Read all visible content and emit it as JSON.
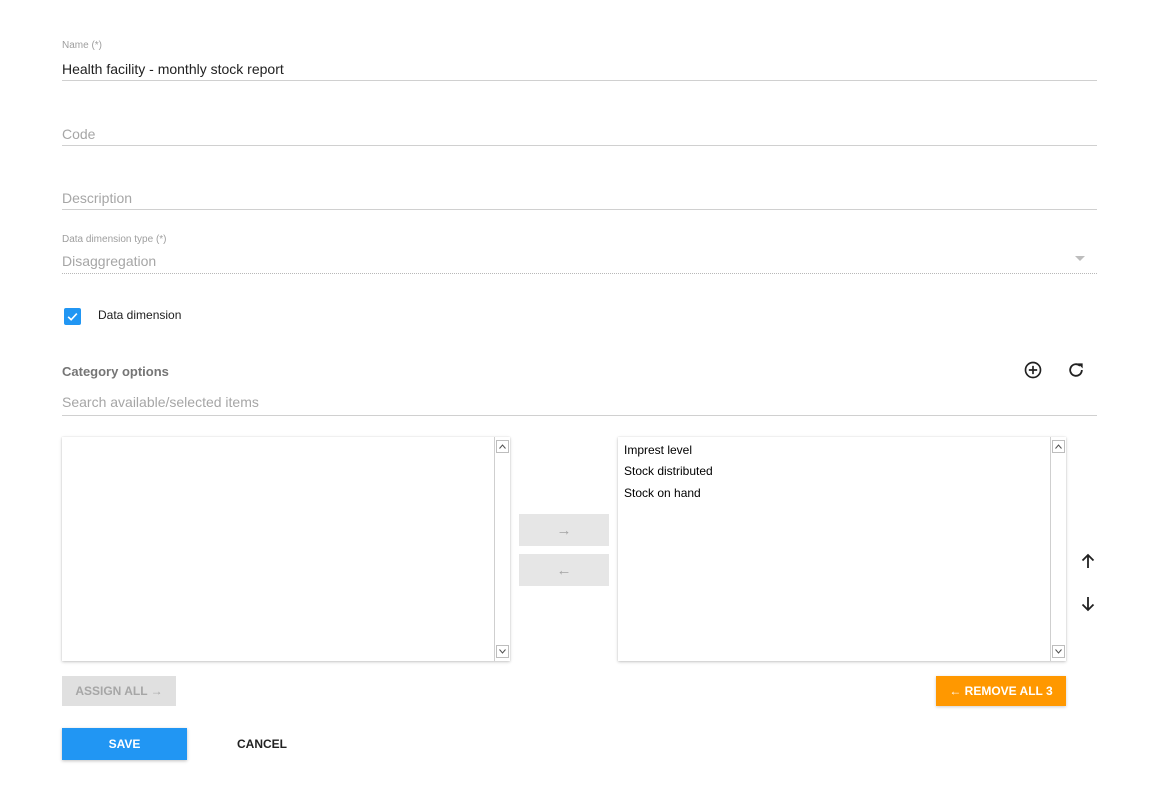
{
  "form": {
    "name": {
      "label": "Name (*)",
      "value": "Health facility - monthly stock report"
    },
    "code": {
      "placeholder": "Code"
    },
    "description": {
      "placeholder": "Description"
    },
    "data_dimension_type": {
      "label": "Data dimension type (*)",
      "value": "Disaggregation"
    },
    "data_dimension": {
      "label": "Data dimension",
      "checked": true
    }
  },
  "category_options": {
    "title": "Category options",
    "search_placeholder": "Search available/selected items",
    "available_items": [],
    "selected_items": [
      "Imprest level",
      "Stock distributed",
      "Stock on hand"
    ],
    "assign_arrow": "→",
    "remove_arrow": "←",
    "assign_all_label": "ASSIGN ALL →",
    "remove_all_label": "← REMOVE ALL 3"
  },
  "actions": {
    "save_label": "SAVE",
    "cancel_label": "CANCEL"
  },
  "colors": {
    "primary": "#2196f3",
    "accent": "#ff9800"
  }
}
